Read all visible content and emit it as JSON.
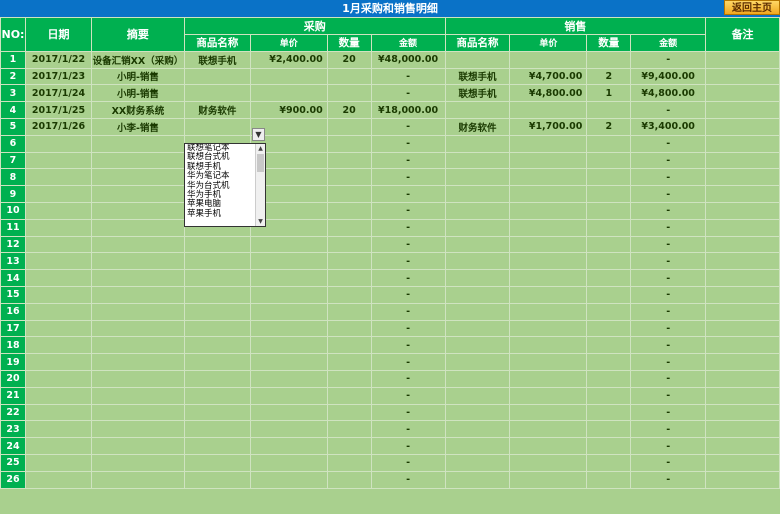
{
  "title": "1月采购和销售明细",
  "return_button": "返回主页",
  "headers": {
    "no": "NO:",
    "date": "日期",
    "summary": "摘要",
    "purchase": "采购",
    "sales": "销售",
    "remark": "备注",
    "product": "商品名称",
    "unit_price": "单价",
    "qty": "数量",
    "amount": "金额"
  },
  "rows": [
    {
      "no": "1",
      "date": "2017/1/22",
      "summary": "设备汇销XX（采购）",
      "p_name": "联想手机",
      "p_price": "¥2,400.00",
      "p_qty": "20",
      "p_amount": "¥48,000.00",
      "s_name": "",
      "s_price": "",
      "s_qty": "",
      "s_amount": "-"
    },
    {
      "no": "2",
      "date": "2017/1/23",
      "summary": "小明-销售",
      "p_name": "",
      "p_price": "",
      "p_qty": "",
      "p_amount": "-",
      "s_name": "联想手机",
      "s_price": "¥4,700.00",
      "s_qty": "2",
      "s_amount": "¥9,400.00"
    },
    {
      "no": "3",
      "date": "2017/1/24",
      "summary": "小明-销售",
      "p_name": "",
      "p_price": "",
      "p_qty": "",
      "p_amount": "-",
      "s_name": "联想手机",
      "s_price": "¥4,800.00",
      "s_qty": "1",
      "s_amount": "¥4,800.00"
    },
    {
      "no": "4",
      "date": "2017/1/25",
      "summary": "XX财务系统",
      "p_name": "财务软件",
      "p_price": "¥900.00",
      "p_qty": "20",
      "p_amount": "¥18,000.00",
      "s_name": "",
      "s_price": "",
      "s_qty": "",
      "s_amount": "-"
    },
    {
      "no": "5",
      "date": "2017/1/26",
      "summary": "小李-销售",
      "p_name": "",
      "p_price": "",
      "p_qty": "",
      "p_amount": "-",
      "s_name": "财务软件",
      "s_price": "¥1,700.00",
      "s_qty": "2",
      "s_amount": "¥3,400.00"
    },
    {
      "no": "6",
      "date": "",
      "summary": "",
      "p_name": "",
      "p_price": "",
      "p_qty": "",
      "p_amount": "-",
      "s_name": "",
      "s_price": "",
      "s_qty": "",
      "s_amount": "-"
    },
    {
      "no": "7",
      "date": "",
      "summary": "",
      "p_name": "",
      "p_price": "",
      "p_qty": "",
      "p_amount": "-",
      "s_name": "",
      "s_price": "",
      "s_qty": "",
      "s_amount": "-"
    },
    {
      "no": "8",
      "date": "",
      "summary": "",
      "p_name": "",
      "p_price": "",
      "p_qty": "",
      "p_amount": "-",
      "s_name": "",
      "s_price": "",
      "s_qty": "",
      "s_amount": "-"
    },
    {
      "no": "9",
      "date": "",
      "summary": "",
      "p_name": "",
      "p_price": "",
      "p_qty": "",
      "p_amount": "-",
      "s_name": "",
      "s_price": "",
      "s_qty": "",
      "s_amount": "-"
    },
    {
      "no": "10",
      "date": "",
      "summary": "",
      "p_name": "",
      "p_price": "",
      "p_qty": "",
      "p_amount": "-",
      "s_name": "",
      "s_price": "",
      "s_qty": "",
      "s_amount": "-"
    },
    {
      "no": "11",
      "date": "",
      "summary": "",
      "p_name": "",
      "p_price": "",
      "p_qty": "",
      "p_amount": "-",
      "s_name": "",
      "s_price": "",
      "s_qty": "",
      "s_amount": "-"
    },
    {
      "no": "12",
      "date": "",
      "summary": "",
      "p_name": "",
      "p_price": "",
      "p_qty": "",
      "p_amount": "-",
      "s_name": "",
      "s_price": "",
      "s_qty": "",
      "s_amount": "-"
    },
    {
      "no": "13",
      "date": "",
      "summary": "",
      "p_name": "",
      "p_price": "",
      "p_qty": "",
      "p_amount": "-",
      "s_name": "",
      "s_price": "",
      "s_qty": "",
      "s_amount": "-"
    },
    {
      "no": "14",
      "date": "",
      "summary": "",
      "p_name": "",
      "p_price": "",
      "p_qty": "",
      "p_amount": "-",
      "s_name": "",
      "s_price": "",
      "s_qty": "",
      "s_amount": "-"
    },
    {
      "no": "15",
      "date": "",
      "summary": "",
      "p_name": "",
      "p_price": "",
      "p_qty": "",
      "p_amount": "-",
      "s_name": "",
      "s_price": "",
      "s_qty": "",
      "s_amount": "-"
    },
    {
      "no": "16",
      "date": "",
      "summary": "",
      "p_name": "",
      "p_price": "",
      "p_qty": "",
      "p_amount": "-",
      "s_name": "",
      "s_price": "",
      "s_qty": "",
      "s_amount": "-"
    },
    {
      "no": "17",
      "date": "",
      "summary": "",
      "p_name": "",
      "p_price": "",
      "p_qty": "",
      "p_amount": "-",
      "s_name": "",
      "s_price": "",
      "s_qty": "",
      "s_amount": "-"
    },
    {
      "no": "18",
      "date": "",
      "summary": "",
      "p_name": "",
      "p_price": "",
      "p_qty": "",
      "p_amount": "-",
      "s_name": "",
      "s_price": "",
      "s_qty": "",
      "s_amount": "-"
    },
    {
      "no": "19",
      "date": "",
      "summary": "",
      "p_name": "",
      "p_price": "",
      "p_qty": "",
      "p_amount": "-",
      "s_name": "",
      "s_price": "",
      "s_qty": "",
      "s_amount": "-"
    },
    {
      "no": "20",
      "date": "",
      "summary": "",
      "p_name": "",
      "p_price": "",
      "p_qty": "",
      "p_amount": "-",
      "s_name": "",
      "s_price": "",
      "s_qty": "",
      "s_amount": "-"
    },
    {
      "no": "21",
      "date": "",
      "summary": "",
      "p_name": "",
      "p_price": "",
      "p_qty": "",
      "p_amount": "-",
      "s_name": "",
      "s_price": "",
      "s_qty": "",
      "s_amount": "-"
    },
    {
      "no": "22",
      "date": "",
      "summary": "",
      "p_name": "",
      "p_price": "",
      "p_qty": "",
      "p_amount": "-",
      "s_name": "",
      "s_price": "",
      "s_qty": "",
      "s_amount": "-"
    },
    {
      "no": "23",
      "date": "",
      "summary": "",
      "p_name": "",
      "p_price": "",
      "p_qty": "",
      "p_amount": "-",
      "s_name": "",
      "s_price": "",
      "s_qty": "",
      "s_amount": "-"
    },
    {
      "no": "24",
      "date": "",
      "summary": "",
      "p_name": "",
      "p_price": "",
      "p_qty": "",
      "p_amount": "-",
      "s_name": "",
      "s_price": "",
      "s_qty": "",
      "s_amount": "-"
    },
    {
      "no": "25",
      "date": "",
      "summary": "",
      "p_name": "",
      "p_price": "",
      "p_qty": "",
      "p_amount": "-",
      "s_name": "",
      "s_price": "",
      "s_qty": "",
      "s_amount": "-"
    },
    {
      "no": "26",
      "date": "",
      "summary": "",
      "p_name": "",
      "p_price": "",
      "p_qty": "",
      "p_amount": "-",
      "s_name": "",
      "s_price": "",
      "s_qty": "",
      "s_amount": "-"
    }
  ],
  "dropdown": {
    "arrow_icon": "chevron-down-icon",
    "options": [
      "联想笔记本",
      "联想台式机",
      "联想手机",
      "华为笔记本",
      "华为台式机",
      "华为手机",
      "苹果电脑",
      "苹果手机"
    ]
  },
  "colors": {
    "title_bar": "#0a72c7",
    "header_green": "#00b050",
    "cell_green": "#a9d08e",
    "button_gold": "#f0a820"
  }
}
